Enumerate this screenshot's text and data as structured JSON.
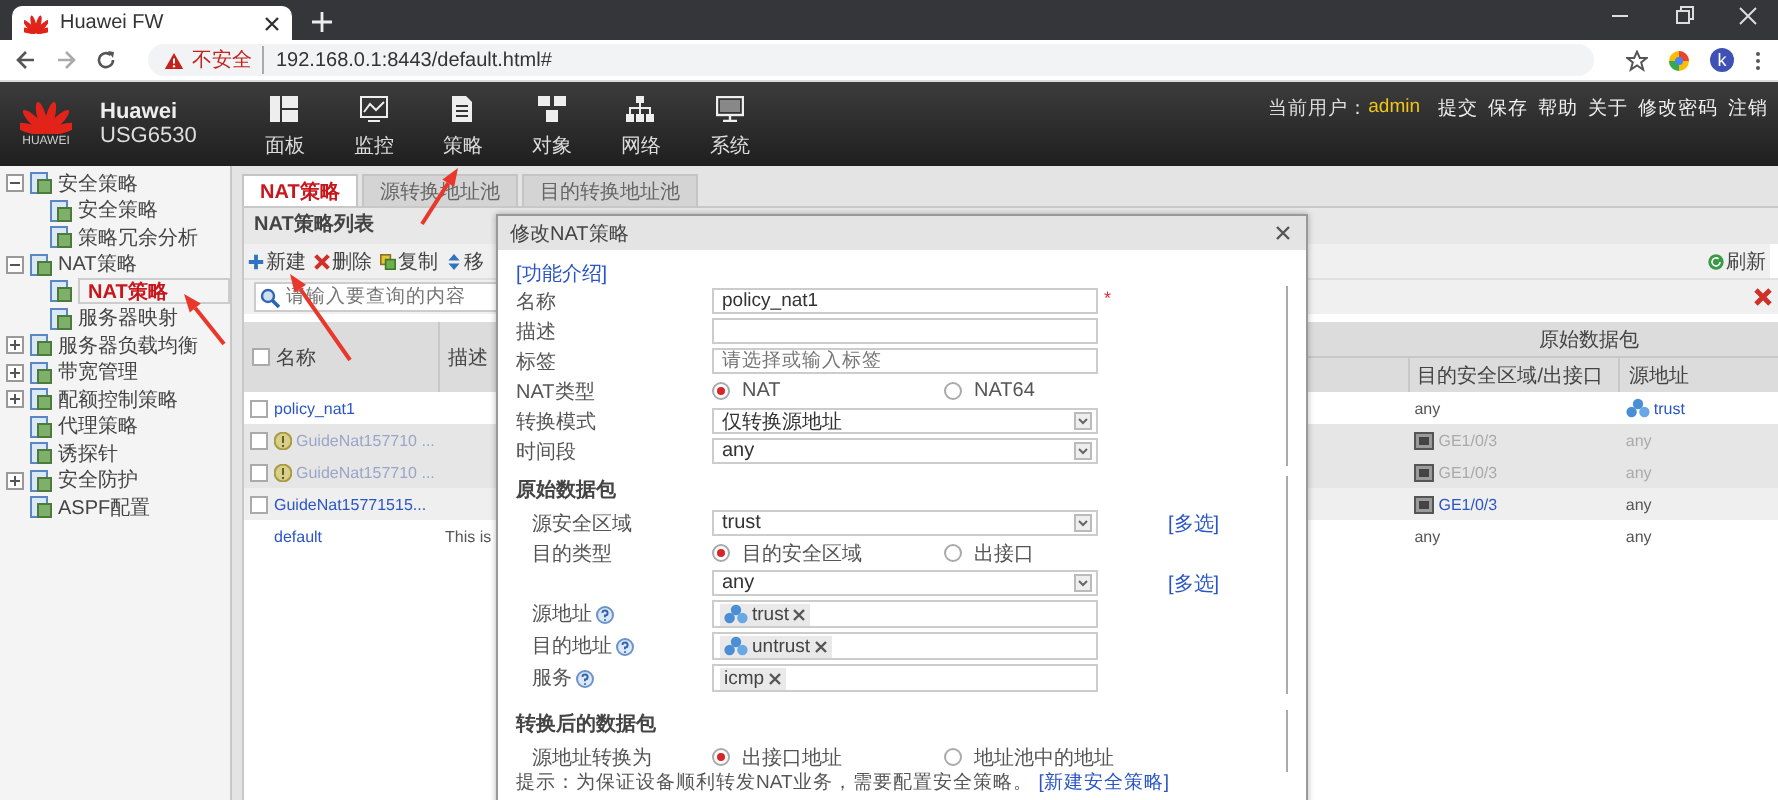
{
  "browser": {
    "tab_title": "Huawei FW",
    "security_label": "不安全",
    "url": "192.168.0.1:8443/default.html#",
    "avatar": "k"
  },
  "app_header": {
    "brand": "Huawei",
    "model": "USG6530",
    "logo_text": "HUAWEI",
    "nav": [
      {
        "label": "面板"
      },
      {
        "label": "监控"
      },
      {
        "label": "策略"
      },
      {
        "label": "对象"
      },
      {
        "label": "网络"
      },
      {
        "label": "系统"
      }
    ],
    "user_label": "当前用户：",
    "user": "admin",
    "actions": [
      "提交",
      "保存",
      "帮助",
      "关于",
      "修改密码",
      "注销"
    ]
  },
  "sidebar": {
    "items": [
      {
        "label": "安全策略",
        "expanded": true,
        "selected": false,
        "children": [
          {
            "label": "安全策略",
            "selected": false
          },
          {
            "label": "策略冗余分析",
            "selected": false
          }
        ]
      },
      {
        "label": "NAT策略",
        "expanded": true,
        "selected": false,
        "children": [
          {
            "label": "NAT策略",
            "selected": true
          },
          {
            "label": "服务器映射",
            "selected": false
          }
        ]
      },
      {
        "label": "服务器负载均衡",
        "expanded": false,
        "selected": false
      },
      {
        "label": "带宽管理",
        "expanded": false,
        "selected": false
      },
      {
        "label": "配额控制策略",
        "expanded": false,
        "selected": false
      },
      {
        "label": "代理策略",
        "selected": false
      },
      {
        "label": "诱探针",
        "selected": false
      },
      {
        "label": "安全防护",
        "expanded": false,
        "selected": false
      },
      {
        "label": "ASPF配置",
        "selected": false
      }
    ]
  },
  "tabs": [
    {
      "label": "NAT策略",
      "selected": true
    },
    {
      "label": "源转换地址池",
      "selected": false
    },
    {
      "label": "目的转换地址池",
      "selected": false
    }
  ],
  "panel": {
    "title": "NAT策略列表",
    "toolbar": [
      {
        "kind": "add",
        "label": "新建"
      },
      {
        "kind": "delete",
        "label": "删除"
      },
      {
        "kind": "copy",
        "label": "复制"
      },
      {
        "kind": "move",
        "label": "移"
      }
    ],
    "refresh": "刷新",
    "search": {
      "placeholder": "请输入要查询的内容"
    }
  },
  "table": {
    "group_header": "原始数据包",
    "columns": [
      "名称",
      "描述",
      "目的安全区域/出接口",
      "源地址"
    ],
    "header_checked": false,
    "rows": [
      {
        "checked": false,
        "disabled": false,
        "name": "policy_nat1",
        "dest": {
          "text": "any",
          "kind": "text"
        },
        "source": {
          "text": "trust",
          "kind": "zone",
          "link": true
        }
      },
      {
        "checked": false,
        "disabled": true,
        "name": "GuideNat157710 ...",
        "dest": {
          "text": "GE1/0/3",
          "kind": "interface",
          "link": false
        },
        "source": {
          "text": "any",
          "kind": "text"
        }
      },
      {
        "checked": false,
        "disabled": true,
        "name": "GuideNat157710 ...",
        "dest": {
          "text": "GE1/0/3",
          "kind": "interface",
          "link": false
        },
        "source": {
          "text": "any",
          "kind": "text"
        }
      },
      {
        "checked": false,
        "disabled": false,
        "name": "GuideNat15771515...",
        "dest": {
          "text": "GE1/0/3",
          "kind": "interface",
          "link": true
        },
        "source": {
          "text": "any",
          "kind": "text"
        }
      },
      {
        "disabled": false,
        "name": "default",
        "description": "This is",
        "dest": {
          "text": "any",
          "kind": "text"
        },
        "source": {
          "text": "any",
          "kind": "text"
        }
      }
    ]
  },
  "dialog": {
    "title": "修改NAT策略",
    "intro_link": "[功能介绍]",
    "sections": [
      {
        "fields": [
          {
            "kind": "text",
            "label": "名称",
            "value": "policy_nat1",
            "mark": "*"
          },
          {
            "kind": "text",
            "label": "描述"
          },
          {
            "kind": "text",
            "label": "标签",
            "placeholder": "请选择或输入标签"
          },
          {
            "kind": "radio",
            "label": "NAT类型",
            "options": [
              {
                "label": "NAT",
                "selected": true
              },
              {
                "label": "NAT64",
                "selected": false
              }
            ]
          },
          {
            "kind": "select",
            "label": "转换模式",
            "value": "仅转换源地址"
          },
          {
            "kind": "select",
            "label": "时间段",
            "value": "any"
          }
        ]
      },
      {
        "heading": "原始数据包",
        "fields": [
          {
            "kind": "select",
            "label": "源安全区域",
            "value": "trust",
            "link": "[多选]"
          },
          {
            "kind": "radio",
            "label": "目的类型",
            "options": [
              {
                "label": "目的安全区域",
                "selected": true
              },
              {
                "label": "出接口",
                "selected": false
              }
            ]
          },
          {
            "kind": "select",
            "value": "any",
            "link": "[多选]"
          },
          {
            "kind": "tags",
            "label": "源地址",
            "help": true,
            "tags": [
              {
                "text": "trust",
                "kind": "zone"
              }
            ]
          },
          {
            "kind": "tags",
            "label": "目的地址",
            "help": true,
            "tags": [
              {
                "text": "untrust",
                "kind": "zone"
              }
            ]
          },
          {
            "kind": "tags",
            "label": "服务",
            "help": true,
            "tags": [
              {
                "text": "icmp",
                "kind": "plain"
              }
            ]
          }
        ]
      },
      {
        "heading": "转换后的数据包",
        "fields": [
          {
            "kind": "radio",
            "label": "源地址转换为",
            "options": [
              {
                "label": "出接口地址",
                "selected": true
              },
              {
                "label": "地址池中的地址",
                "selected": false
              }
            ]
          }
        ]
      }
    ],
    "hint": {
      "text": "提示：为保证设备顺利转发NAT业务，需要配置安全策略。",
      "link": "[新建安全策略]"
    }
  }
}
